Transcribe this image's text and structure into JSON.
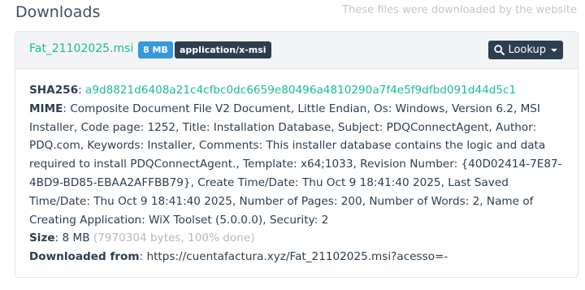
{
  "header": {
    "title": "Downloads",
    "subtitle": "These files were downloaded by the website"
  },
  "file": {
    "name": "Fat_21102025.msi",
    "size_badge": "8 MB",
    "mime_badge": "application/x-msi",
    "lookup_label": "Lookup",
    "sha256_label": "SHA256",
    "sha256_value": "a9d8821d6408a21c4cfbc0dc6659e80496a4810290a7f4e5f9dfbd091d44d5c1",
    "mime_label": "MIME",
    "mime_value": "Composite Document File V2 Document, Little Endian, Os: Windows, Version 6.2, MSI Installer, Code page: 1252, Title: Installation Database, Subject: PDQConnectAgent, Author: PDQ.com, Keywords: Installer, Comments: This installer database contains the logic and data required to install PDQConnectAgent., Template: x64;1033, Revision Number: {40D02414-7E87-4BD9-BD85-EBAA2AFFBB79}, Create Time/Date: Thu Oct 9 18:41:40 2025, Last Saved Time/Date: Thu Oct 9 18:41:40 2025, Number of Pages: 200, Number of Words: 2, Name of Creating Application: WiX Toolset (5.0.0.0), Security: 2",
    "size_label": "Size",
    "size_value": "8 MB",
    "size_detail": "(7970304 bytes, 100% done)",
    "downloaded_from_label": "Downloaded from",
    "downloaded_from_value": "https://cuentafactura.xyz/Fat_21102025.msi?acesso=-"
  },
  "icons": {
    "lookup": "search-icon",
    "dropdown": "caret-down-icon"
  },
  "colors": {
    "accent_green": "#18bc9c",
    "badge_blue": "#3498db",
    "dark": "#2c3e50"
  }
}
